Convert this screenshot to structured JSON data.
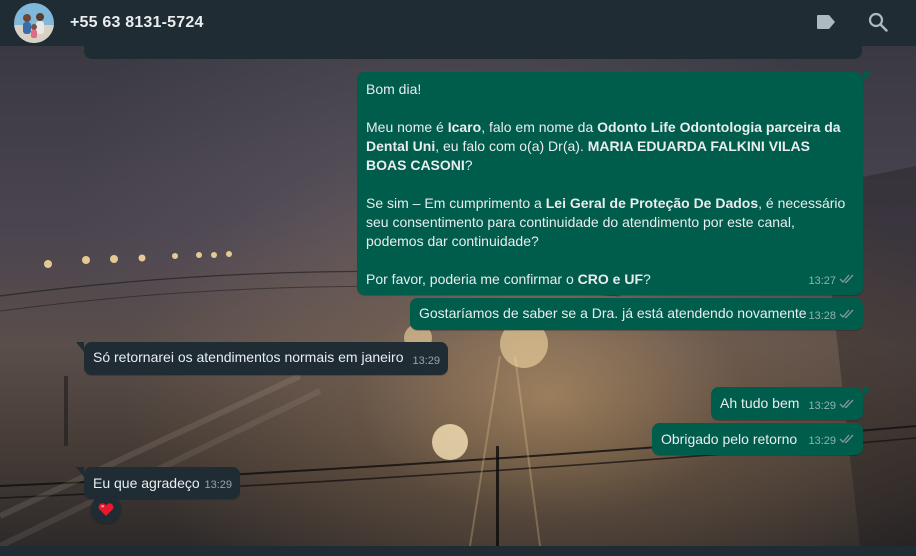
{
  "header": {
    "contact_name": "+55 63 8131-5724",
    "avatar_icon": "profile-photo",
    "label_icon": "label-icon",
    "search_icon": "search-icon"
  },
  "colors": {
    "header_bg": "#202c33",
    "outgoing_bubble": "#005c4b",
    "incoming_bubble": "#202c33",
    "read_tick": "#8696a0"
  },
  "messages": {
    "m1": {
      "greeting": "Bom dia!",
      "p2_a": "Meu nome é ",
      "p2_name": "Icaro",
      "p2_b": ", falo em nome da ",
      "p2_company": "Odonto Life Odontologia parceira da Dental Uni",
      "p2_c": ", eu falo com o(a) Dr(a). ",
      "p2_doctor": "MARIA EDUARDA FALKINI VILAS BOAS CASONI",
      "p2_d": "?",
      "p3_a": "Se sim – Em cumprimento a ",
      "p3_law": "Lei Geral de Proteção De Dados",
      "p3_b": ", é necessário seu consentimento para continuidade do atendimento por este canal, podemos dar continuidade?",
      "p4_a": "Por favor, poderia me confirmar o ",
      "p4_cro": "CRO e UF",
      "p4_b": "?",
      "time": "13:27"
    },
    "m2": {
      "text": "Gostaríamos de saber se a Dra. já está atendendo novamente",
      "time": "13:28"
    },
    "m3": {
      "text": "Só retornarei os atendimentos normais em janeiro",
      "time": "13:29"
    },
    "m4": {
      "text": "Ah tudo bem",
      "time": "13:29"
    },
    "m5": {
      "text": "Obrigado pelo retorno",
      "time": "13:29"
    },
    "m6": {
      "text": "Eu que agradeço",
      "time": "13:29",
      "reaction": "❤️"
    }
  }
}
